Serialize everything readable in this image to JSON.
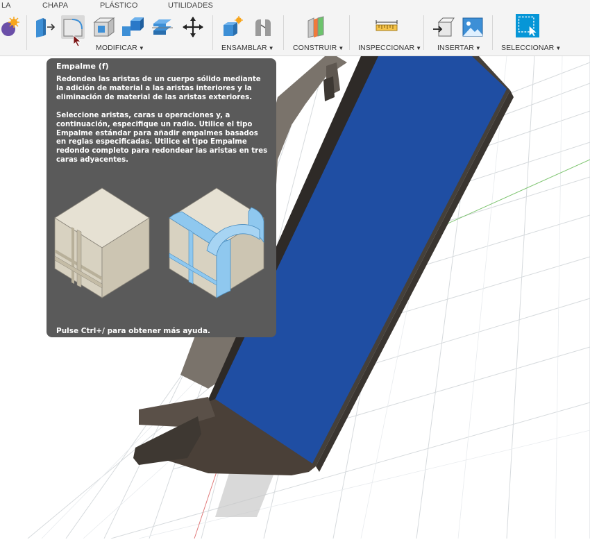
{
  "tabs": [
    {
      "label": "LA"
    },
    {
      "label": "CHAPA"
    },
    {
      "label": "PLÁSTICO"
    },
    {
      "label": "UTILIDADES"
    }
  ],
  "groups": {
    "modify": "MODIFICAR",
    "assemble": "ENSAMBLAR",
    "construct": "CONSTRUIR",
    "inspect": "INSPECCIONAR",
    "insert": "INSERTAR",
    "select": "SELECCIONAR"
  },
  "tooltip": {
    "title": "Empalme (f)",
    "paragraph1": "Redondea las aristas de un cuerpo sólido mediante la adición de material a las aristas interiores y la eliminación de material de las aristas exteriores.",
    "paragraph2": "Seleccione aristas, caras u operaciones y, a continuación, especifique un radio. Utilice el tipo Empalme estándar para añadir empalmes basados en reglas especificadas. Utilice el tipo Empalme redondo completo para redondear las aristas en tres caras adyacentes.",
    "footer": "Pulse Ctrl+/ para obtener más ayuda."
  },
  "colors": {
    "accent": "#0696d7",
    "tooltip_bg": "#5a5a5a",
    "model_blue": "#1f4ea3",
    "model_wood": "#4a4038",
    "fillet_blue": "#8fc8ef"
  },
  "icons": {
    "create": "create-form-icon",
    "push_pull": "push-pull-icon",
    "fillet": "fillet-icon",
    "shell": "shell-icon",
    "combine": "combine-icon",
    "split": "split-body-icon",
    "move": "move-icon",
    "new_component": "new-component-icon",
    "joint": "joint-icon",
    "midplane": "midplane-icon",
    "measure": "measure-icon",
    "insert_derive": "insert-derive-icon",
    "canvas": "canvas-image-icon",
    "select": "select-icon"
  }
}
